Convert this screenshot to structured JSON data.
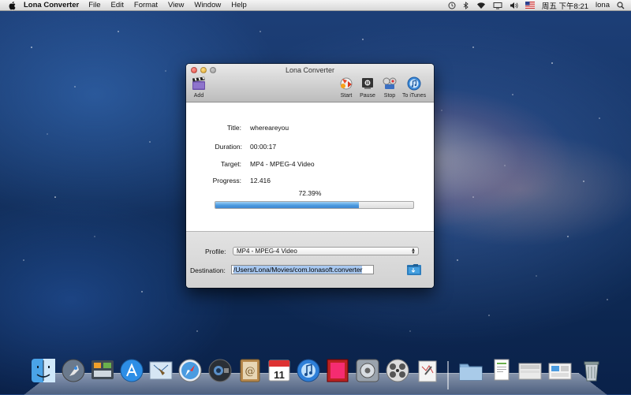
{
  "menubar": {
    "app_name": "Lona Converter",
    "items": [
      "File",
      "Edit",
      "Format",
      "View",
      "Window",
      "Help"
    ],
    "clock": "周五 下午8:21",
    "user": "lona",
    "status_icons": [
      "time-machine-icon",
      "bluetooth-icon",
      "wifi-icon",
      "display-icon",
      "volume-icon",
      "us-flag-icon",
      "spotlight-icon"
    ]
  },
  "window": {
    "title": "Lona Converter",
    "toolbar": {
      "add": "Add",
      "start": "Start",
      "pause": "Pause",
      "stop": "Stop",
      "to_itunes": "To iTunes"
    },
    "info": {
      "title_label": "Title:",
      "title_value": "whereareyou",
      "duration_label": "Duration:",
      "duration_value": "00:00:17",
      "target_label": "Target:",
      "target_value": "MP4 - MPEG-4 Video",
      "progress_label": "Progress:",
      "progress_value": "12.416",
      "percent": "72.39%",
      "percent_fraction": 0.7239
    },
    "profile": {
      "label": "Profile:",
      "selected": "MP4 - MPEG-4 Video"
    },
    "destination": {
      "label": "Destination:",
      "value": "/Users/Lona/Movies/com.lonasoft.converter"
    }
  },
  "dock": {
    "icons": [
      "finder-icon",
      "launchpad-icon",
      "mission-control-icon",
      "app-store-icon",
      "mail-icon",
      "safari-icon",
      "facetime-icon",
      "address-book-icon",
      "ical-icon",
      "itunes-icon",
      "photo-booth-icon",
      "system-preferences-icon",
      "dvd-player-icon",
      "preview-icon",
      "applications-folder-icon",
      "documents-icon",
      "downloads-icon",
      "stack-icon",
      "trash-icon"
    ],
    "calendar_day": "11"
  },
  "colors": {
    "progress_fill": "#4c9be0",
    "desktop": "#163566"
  }
}
